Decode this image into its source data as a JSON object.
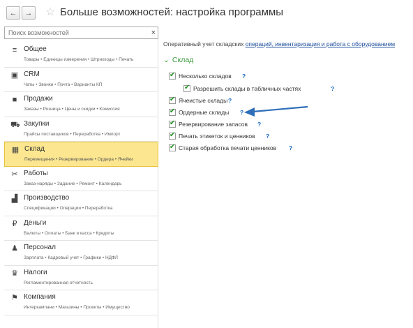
{
  "header": {
    "back_glyph": "←",
    "forward_glyph": "→",
    "title": "Больше возможностей: настройка программы"
  },
  "search": {
    "placeholder": "Поиск возможностей",
    "clear": "×"
  },
  "menu": [
    {
      "label": "Общее",
      "sub": "Товары • Единицы измерения • Штрихкоды • Печать",
      "icon": "list-icon",
      "glyph": "≡"
    },
    {
      "label": "CRM",
      "sub": "Чаты • Звонки • Почта • Варианты КП",
      "icon": "crm-icon",
      "glyph": "▣"
    },
    {
      "label": "Продажи",
      "sub": "Заказы • Розница • Цены и скидки • Комиссия",
      "icon": "briefcase-icon",
      "glyph": "■"
    },
    {
      "label": "Закупки",
      "sub": "Прайсы поставщиков • Переработка • Импорт",
      "icon": "cart-icon",
      "glyph": "⛟"
    },
    {
      "label": "Склад",
      "sub": "Перемещения • Резервирование • Ордера • Ячейки",
      "icon": "warehouse-icon",
      "glyph": "▦",
      "selected": true
    },
    {
      "label": "Работы",
      "sub": "Заказ-наряды • Задание • Ремонт • Календарь",
      "icon": "tools-icon",
      "glyph": "✂"
    },
    {
      "label": "Производство",
      "sub": "Спецификации • Операции • Переработка",
      "icon": "factory-icon",
      "glyph": "▟"
    },
    {
      "label": "Деньги",
      "sub": "Валюты • Оплаты • Банк и касса • Кредиты",
      "icon": "ruble-icon",
      "glyph": "₽"
    },
    {
      "label": "Персонал",
      "sub": "Зарплата • Кадровый учет • Графики • НДФЛ",
      "icon": "person-icon",
      "glyph": "♟"
    },
    {
      "label": "Налоги",
      "sub": "Регламентированная отчетность",
      "icon": "emblem-icon",
      "glyph": "♛"
    },
    {
      "label": "Компания",
      "sub": "Интеркампани • Магазины • Проекты • Имущество",
      "icon": "flag-icon",
      "glyph": "⚑"
    }
  ],
  "main": {
    "desc_text": "Оперативный учет складских ",
    "desc_link": "операций, инвентаризация и работа с оборудованием",
    "group_title": "Склад",
    "chevron": "⌄",
    "help": "?",
    "options": [
      {
        "label": "Несколько складов",
        "checked": true
      },
      {
        "label": "Разрешить склады в табличных частях",
        "checked": true,
        "indent": true
      },
      {
        "label": "Ячеистые склады",
        "checked": true
      },
      {
        "label": "Ордерные склады",
        "checked": true
      },
      {
        "label": "Резервирование запасов",
        "checked": true
      },
      {
        "label": "Печать этикеток и ценников",
        "checked": true
      },
      {
        "label": "Старая обработка печати ценников",
        "checked": true
      }
    ]
  },
  "colors": {
    "accent_green": "#3d9b3d",
    "selected_bg": "#fce790",
    "arrow_blue": "#2f6fb9",
    "link": "#1a4b9b"
  }
}
